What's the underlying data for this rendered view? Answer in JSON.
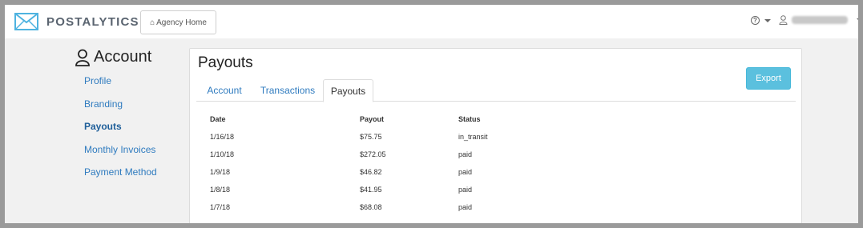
{
  "header": {
    "logo_text": "POSTALYTICS",
    "agency_home_label": "Agency Home",
    "help_icon": "?"
  },
  "sidebar": {
    "title": "Account",
    "items": [
      {
        "label": "Profile"
      },
      {
        "label": "Branding"
      },
      {
        "label": "Payouts"
      },
      {
        "label": "Monthly Invoices"
      },
      {
        "label": "Payment Method"
      }
    ]
  },
  "main": {
    "title": "Payouts",
    "export_label": "Export",
    "tabs": [
      {
        "label": "Account"
      },
      {
        "label": "Transactions"
      },
      {
        "label": "Payouts"
      }
    ],
    "table": {
      "headers": [
        "Date",
        "Payout",
        "Status"
      ],
      "rows": [
        [
          "1/16/18",
          "$75.75",
          "in_transit"
        ],
        [
          "1/10/18",
          "$272.05",
          "paid"
        ],
        [
          "1/9/18",
          "$46.82",
          "paid"
        ],
        [
          "1/8/18",
          "$41.95",
          "paid"
        ],
        [
          "1/7/18",
          "$68.08",
          "paid"
        ]
      ]
    }
  },
  "colors": {
    "link": "#2f7bbf",
    "export_button": "#5bc0de",
    "logo_accent": "#4fb3e0"
  }
}
